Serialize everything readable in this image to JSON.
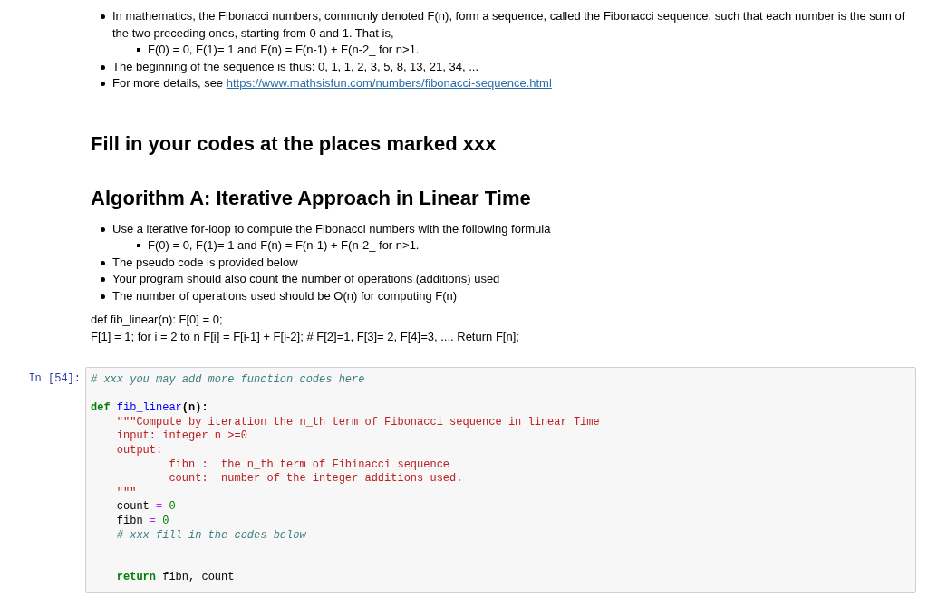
{
  "intro_list": [
    {
      "text": "In mathematics, the Fibonacci numbers, commonly denoted F(n), form a sequence, called the Fibonacci sequence, such that each number is the sum of the two preceding ones, starting from 0 and 1. That is,",
      "children": [
        {
          "text": "F(0) = 0, F(1)= 1 and F(n) = F(n-1) + F(n-2_ for n>1."
        }
      ]
    },
    {
      "text": "The beginning of the sequence is thus: 0, 1, 1, 2, 3, 5, 8, 13, 21, 34, ..."
    },
    {
      "text": "For more details, see ",
      "link": "https://www.mathsisfun.com/numbers/fibonacci-sequence.html"
    }
  ],
  "heading_1": "Fill in your codes at the places marked xxx",
  "heading_2": "Algorithm A: Iterative Approach in Linear Time",
  "algorithm_list": [
    {
      "text": "Use a iterative for-loop to compute the Fibonacci numbers with the following formula",
      "children": [
        {
          "text": "F(0) = 0, F(1)= 1 and F(n) = F(n-1) + F(n-2_ for n>1."
        }
      ]
    },
    {
      "text": "The pseudo code is provided below"
    },
    {
      "text": "Your program should also count the number of operations (additions) used"
    },
    {
      "text": "The number of operations used should be O(n) for computing F(n)"
    }
  ],
  "pseudo_code": [
    "def fib_linear(n): F[0] = 0;",
    "F[1] = 1; for i = 2 to n F[i] = F[i-1] + F[i-2]; # F[2]=1, F[3]= 2, F[4]=3, .... Return F[n];"
  ],
  "code_cell": {
    "prompt": "In [54]:",
    "lines": [
      {
        "kind": "code",
        "tokens": [
          {
            "kind": "comment",
            "text": "# xxx you may add more function codes here"
          }
        ]
      },
      {
        "kind": "blank"
      },
      {
        "kind": "code",
        "tokens": [
          {
            "kind": "keyword",
            "text": "def"
          },
          {
            "kind": "function",
            "text": " fib_linear"
          },
          {
            "kind": "punct",
            "text": "(n):"
          }
        ]
      },
      {
        "kind": "code",
        "tokens": [
          {
            "kind": "string",
            "text": "    \"\"\"Compute by iteration the n_th term of Fibonacci sequence in linear Time"
          }
        ]
      },
      {
        "kind": "code",
        "tokens": [
          {
            "kind": "string",
            "text": "    input: integer n >=0"
          }
        ]
      },
      {
        "kind": "code",
        "tokens": [
          {
            "kind": "string",
            "text": "    output:"
          }
        ]
      },
      {
        "kind": "code",
        "tokens": [
          {
            "kind": "string",
            "text": "            fibn :  the n_th term of Fibinacci sequence"
          }
        ]
      },
      {
        "kind": "code",
        "tokens": [
          {
            "kind": "string",
            "text": "            count:  number of the integer additions used."
          }
        ]
      },
      {
        "kind": "code",
        "tokens": [
          {
            "kind": "string",
            "text": "    \"\"\""
          }
        ]
      },
      {
        "kind": "code",
        "tokens": [
          {
            "kind": "plain",
            "text": "    count "
          },
          {
            "kind": "operator",
            "text": "="
          },
          {
            "kind": "number",
            "text": " 0"
          }
        ]
      },
      {
        "kind": "code",
        "tokens": [
          {
            "kind": "plain",
            "text": "    fibn "
          },
          {
            "kind": "operator",
            "text": "="
          },
          {
            "kind": "number",
            "text": " 0"
          }
        ]
      },
      {
        "kind": "code",
        "tokens": [
          {
            "kind": "comment",
            "text": "    # xxx fill in the codes below"
          }
        ]
      },
      {
        "kind": "blank"
      },
      {
        "kind": "blank"
      },
      {
        "kind": "code",
        "tokens": [
          {
            "kind": "keyword",
            "text": "    return"
          },
          {
            "kind": "plain",
            "text": " fibn, count"
          }
        ]
      }
    ]
  }
}
